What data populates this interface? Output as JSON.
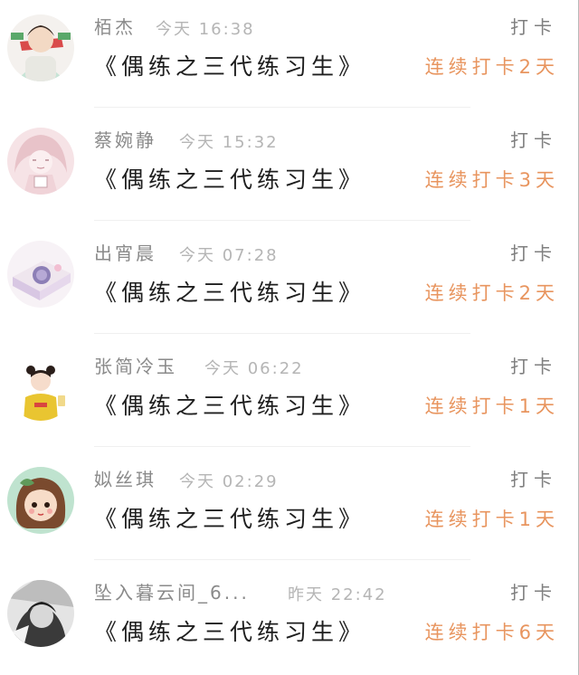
{
  "entries": [
    {
      "name": "栢杰",
      "time": "今天 16:38",
      "action": "打卡",
      "title": "《偶练之三代练习生》",
      "streak": "连续打卡2天",
      "avatar": "avatar-girl-scarf"
    },
    {
      "name": "蔡婉静",
      "time": "今天 15:32",
      "action": "打卡",
      "title": "《偶练之三代练习生》",
      "streak": "连续打卡3天",
      "avatar": "avatar-sketch-girl"
    },
    {
      "name": "出宵晨",
      "time": "今天 07:28",
      "action": "打卡",
      "title": "《偶练之三代练习生》",
      "streak": "连续打卡2天",
      "avatar": "avatar-lavender-box"
    },
    {
      "name": "张简冷玉",
      "time": "今天 06:22",
      "action": "打卡",
      "title": "《偶练之三代练习生》",
      "streak": "连续打卡1天",
      "avatar": "avatar-cartoon-yellow-shirt"
    },
    {
      "name": "姒丝琪",
      "time": "今天 02:29",
      "action": "打卡",
      "title": "《偶练之三代练习生》",
      "streak": "连续打卡1天",
      "avatar": "avatar-cartoon-girl-bow"
    },
    {
      "name": "坠入暮云间_6...",
      "time": "昨天 22:42",
      "action": "打卡",
      "title": "《偶练之三代练习生》",
      "streak": "连续打卡6天",
      "avatar": "avatar-monochrome-portrait"
    }
  ]
}
